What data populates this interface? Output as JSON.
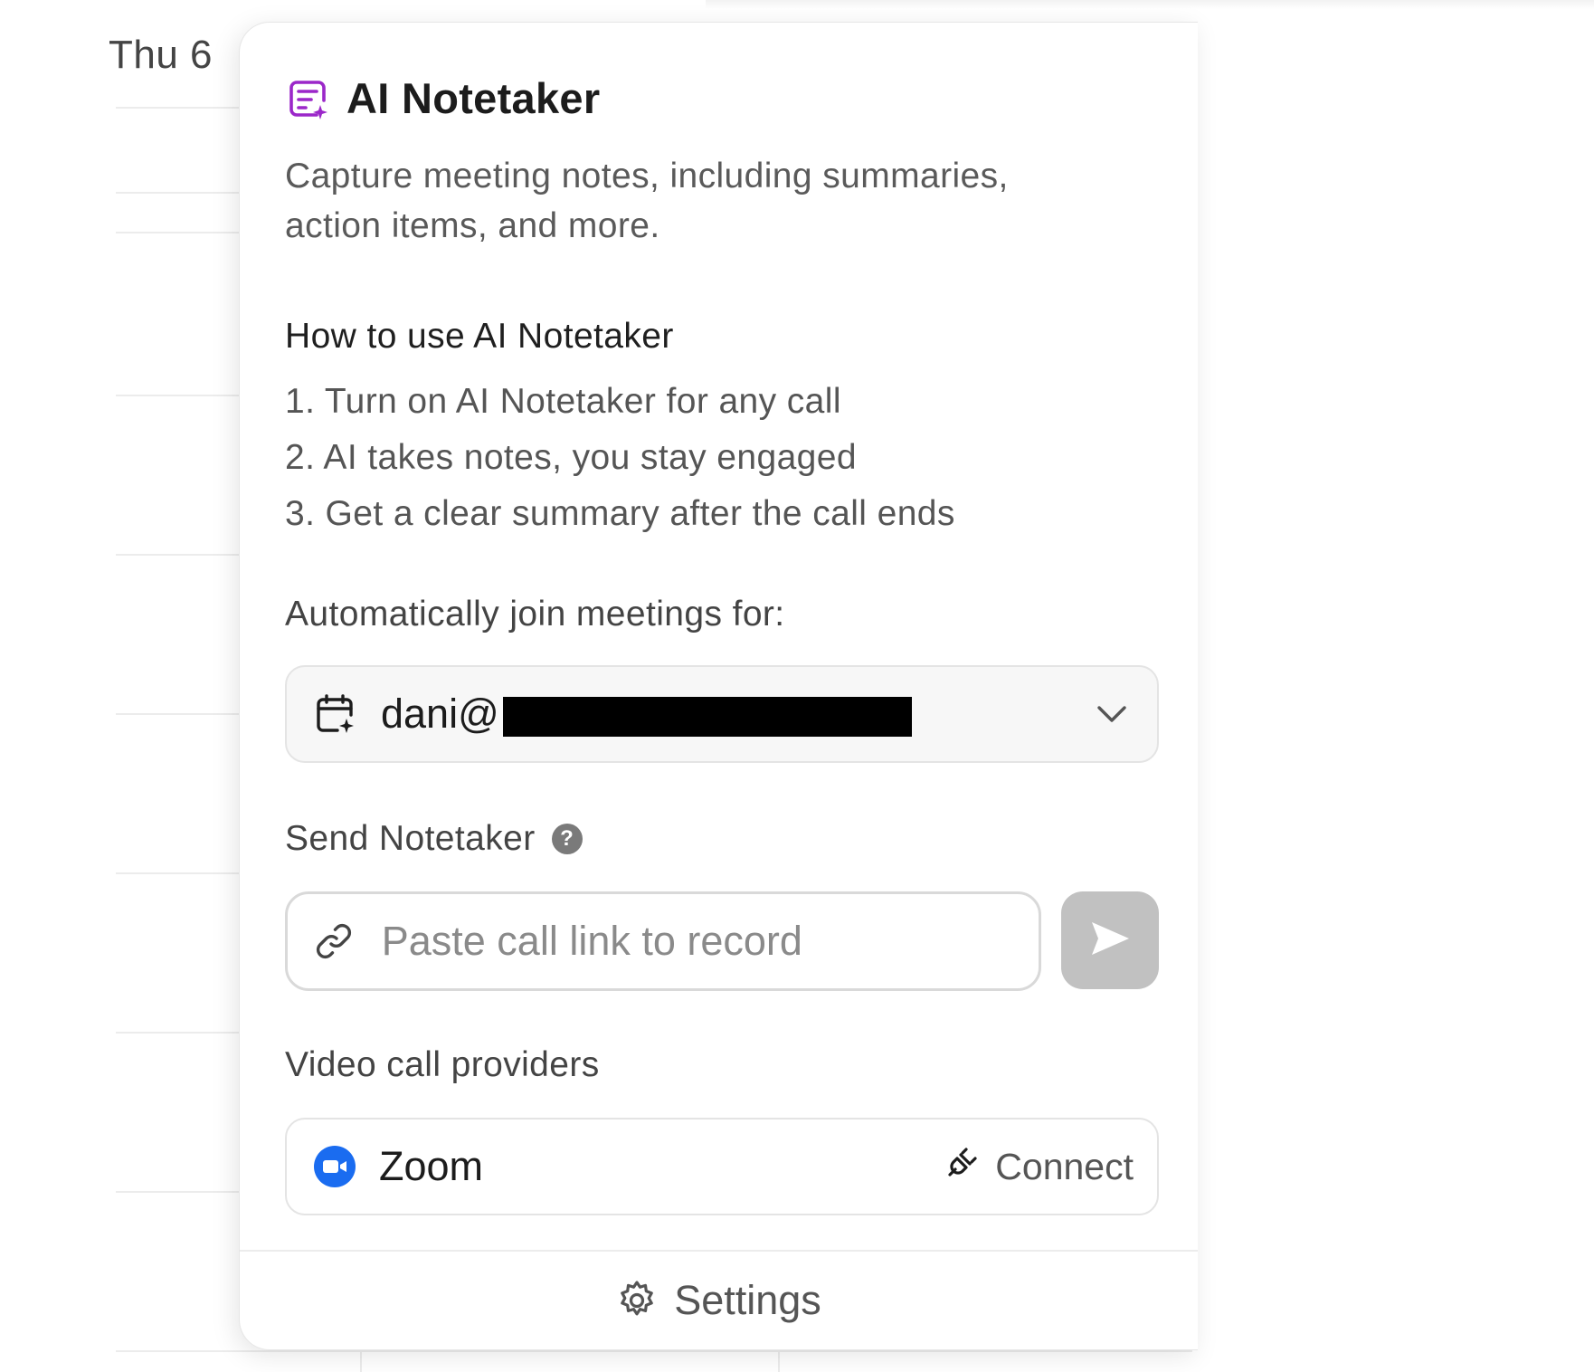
{
  "calendar": {
    "day_label": "Thu 6"
  },
  "panel": {
    "title": "AI Notetaker",
    "description": "Capture meeting notes, including summaries, action items, and more.",
    "howto_title": "How to use AI Notetaker",
    "steps": [
      "1. Turn on AI Notetaker for any call",
      "2. AI takes notes, you stay engaged",
      "3. Get a clear summary after the call ends"
    ],
    "auto_join_label": "Automatically join meetings for:",
    "account": {
      "email_prefix": "dani@"
    },
    "send_notetaker_label": "Send Notetaker",
    "call_link": {
      "placeholder": "Paste call link to record",
      "value": ""
    },
    "video_providers_label": "Video call providers",
    "providers": [
      {
        "name": "Zoom",
        "action": "Connect"
      }
    ],
    "footer": {
      "settings_label": "Settings"
    }
  },
  "colors": {
    "accent_purple": "#9b27c9",
    "zoom_blue": "#1a6cf0",
    "send_button_disabled": "#c1c1c1"
  },
  "icons": [
    "notes-sparkle-icon",
    "calendar-sparkle-icon",
    "chevron-down-icon",
    "help-icon",
    "link-icon",
    "send-icon",
    "zoom-icon",
    "plug-icon",
    "gear-icon"
  ]
}
